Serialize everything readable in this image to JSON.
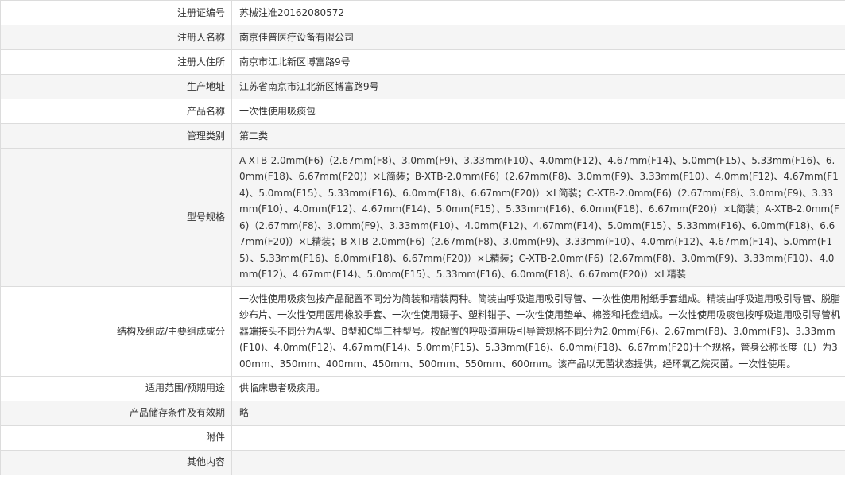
{
  "rows": [
    {
      "label": "注册证编号",
      "value": "苏械注准20162080572"
    },
    {
      "label": "注册人名称",
      "value": "南京佳普医疗设备有限公司"
    },
    {
      "label": "注册人住所",
      "value": "南京市江北新区博富路9号"
    },
    {
      "label": "生产地址",
      "value": "江苏省南京市江北新区博富路9号"
    },
    {
      "label": "产品名称",
      "value": "一次性使用吸痰包"
    },
    {
      "label": "管理类别",
      "value": "第二类"
    },
    {
      "label": "型号规格",
      "value": "A-XTB-2.0mm(F6)（2.67mm(F8)、3.0mm(F9)、3.33mm(F10）、4.0mm(F12)、4.67mm(F14)、5.0mm(F15）、5.33mm(F16)、6.0mm(F18)、6.67mm(F20)）×L简装；B-XTB-2.0mm(F6)（2.67mm(F8)、3.0mm(F9)、3.33mm(F10）、4.0mm(F12)、4.67mm(F14)、5.0mm(F15）、5.33mm(F16)、6.0mm(F18)、6.67mm(F20)）×L简装；C-XTB-2.0mm(F6)（2.67mm(F8)、3.0mm(F9)、3.33mm(F10）、4.0mm(F12)、4.67mm(F14)、5.0mm(F15）、5.33mm(F16)、6.0mm(F18)、6.67mm(F20)）×L简装；A-XTB-2.0mm(F6)（2.67mm(F8)、3.0mm(F9)、3.33mm(F10）、4.0mm(F12)、4.67mm(F14)、5.0mm(F15）、5.33mm(F16)、6.0mm(F18)、6.67mm(F20)）×L精装；B-XTB-2.0mm(F6)（2.67mm(F8)、3.0mm(F9)、3.33mm(F10）、4.0mm(F12)、4.67mm(F14)、5.0mm(F15）、5.33mm(F16)、6.0mm(F18)、6.67mm(F20)）×L精装；C-XTB-2.0mm(F6)（2.67mm(F8)、3.0mm(F9)、3.33mm(F10）、4.0mm(F12)、4.67mm(F14)、5.0mm(F15）、5.33mm(F16)、6.0mm(F18)、6.67mm(F20)）×L精装"
    },
    {
      "label": "结构及组成/主要组成成分",
      "value": "一次性使用吸痰包按产品配置不同分为简装和精装两种。简装由呼吸道用吸引导管、一次性使用附纸手套组成。精装由呼吸道用吸引导管、脱脂纱布片、一次性使用医用橡胶手套、一次性使用镊子、塑料钳子、一次性使用垫单、棉签和托盘组成。一次性使用吸痰包按呼吸道用吸引导管机器端接头不同分为A型、B型和C型三种型号。按配置的呼吸道用吸引导管规格不同分为2.0mm(F6)、2.67mm(F8)、3.0mm(F9)、3.33mm(F10)、4.0mm(F12)、4.67mm(F14)、5.0mm(F15)、5.33mm(F16)、6.0mm(F18)、6.67mm(F20)十个规格，管身公称长度（L）为300mm、350mm、400mm、450mm、500mm、550mm、600mm。该产品以无菌状态提供，经环氧乙烷灭菌。一次性使用。"
    },
    {
      "label": "适用范围/预期用途",
      "value": "供临床患者吸痰用。"
    },
    {
      "label": "产品储存条件及有效期",
      "value": "略"
    },
    {
      "label": "附件",
      "value": ""
    },
    {
      "label": "其他内容",
      "value": ""
    }
  ]
}
